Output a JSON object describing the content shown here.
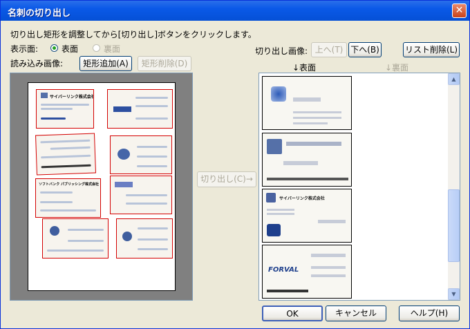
{
  "window": {
    "title": "名刺の切り出し",
    "close_glyph": "✕"
  },
  "instruction": "切り出し矩形を調整してから[切り出し]ボタンをクリックします。",
  "display_side": {
    "label": "表示面:",
    "front": "表面",
    "back": "裏面"
  },
  "load_image": {
    "label": "読み込み画像:",
    "add_rect": "矩形追加(A)",
    "delete_rect": "矩形削除(D)"
  },
  "crop_button": "切り出し(C)→",
  "cropped_images": {
    "label": "切り出し画像:",
    "up": "上へ(T)",
    "down": "下へ(B)",
    "clear": "リスト削除(L)",
    "col_front": "↓表面",
    "col_back": "↓裏面",
    "cards": [
      {
        "company": ""
      },
      {
        "company": ""
      },
      {
        "company": "サイバーリンク株式会社"
      },
      {
        "company": "FORVAL"
      }
    ]
  },
  "left_page_cards": [
    {
      "text": "サイバーリンク株式会社"
    },
    {
      "text": ""
    },
    {
      "text": ""
    },
    {
      "text": ""
    },
    {
      "text": "ソフトバンク パブリッシング株式会社"
    },
    {
      "text": ""
    },
    {
      "text": ""
    },
    {
      "text": ""
    }
  ],
  "footer": {
    "ok": "OK",
    "cancel": "キャンセル",
    "help": "ヘルプ(H)"
  },
  "colors": {
    "titlebar": "#0A59E7",
    "crop_rect": "#D40000",
    "window_bg": "#ECE9D8"
  }
}
